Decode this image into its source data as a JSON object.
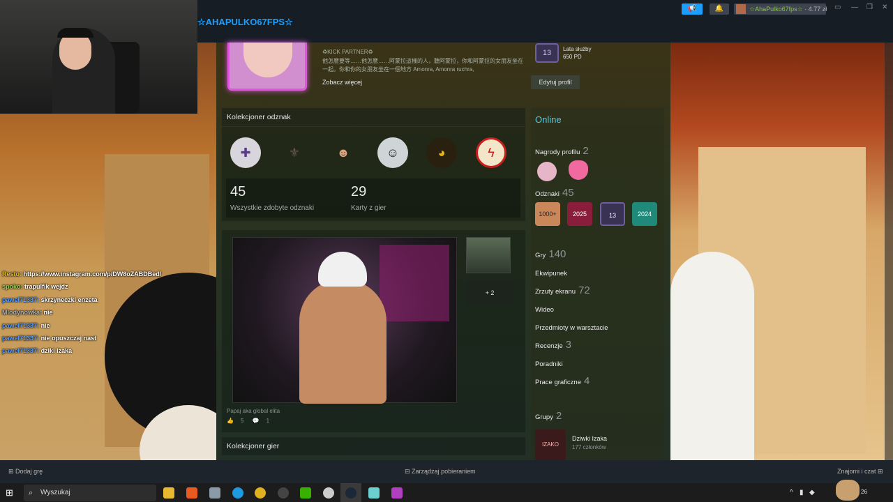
{
  "topbar": {
    "profile_name": "☆AHAPULKO67FPS☆",
    "user_chip_name": "☆AhaPulko67fps☆",
    "wallet": "4.77 zł"
  },
  "profile": {
    "kick_partner": "♻KICK PARTNER♻",
    "bio": "他怎麼要等……他怎麼……阿蒙拉這樣的人，聽阿蒙拉，你和阿蒙拉的女朋友坐在一起。你和你的女朋友坐在一個地方 Amonra, Amonra ruchra,",
    "see_more": "Zobacz więcej",
    "level": "13",
    "service_title": "Lata służby",
    "service_xp": "650 PD",
    "edit_profile": "Edytuj profil"
  },
  "badge_collector": {
    "title": "Kolekcjoner odznak",
    "badges": [
      "shield-badge",
      "skyrim-badge",
      "face-badge",
      "ghost-badge",
      "gold-helmet-badge",
      "lightning-badge"
    ],
    "total_badges": "45",
    "total_badges_label": "Wszystkie zdobyte odznaki",
    "cards": "29",
    "cards_label": "Karty z gier"
  },
  "showcase": {
    "more_count": "+ 2",
    "caption": "Papaj aka global elita",
    "likes": "5",
    "comments": "1"
  },
  "games_collector": {
    "title": "Kolekcjoner gier"
  },
  "sidebar": {
    "status": "Online",
    "awards_label": "Nagrody profilu",
    "awards_count": "2",
    "badges_label": "Odznaki",
    "badges_count": "45",
    "side_badges": [
      "1000+",
      "2025",
      "13",
      "2024"
    ],
    "games_label": "Gry",
    "games_count": "140",
    "inventory_label": "Ekwipunek",
    "screenshots_label": "Zrzuty ekranu",
    "screenshots_count": "72",
    "videos_label": "Wideo",
    "workshop_label": "Przedmioty w warsztacie",
    "reviews_label": "Recenzje",
    "reviews_count": "3",
    "guides_label": "Poradniki",
    "artwork_label": "Prace graficzne",
    "artwork_count": "4",
    "groups_label": "Grupy",
    "groups_count": "2",
    "group_name": "Dziwki Izaka",
    "group_members": "177 członków",
    "group_icon_text": "IZAKO BOARS"
  },
  "chat": [
    {
      "user": "Resto:",
      "msg": "https://www.instagram.com/p/DW8oZABDBed/"
    },
    {
      "user": "spoko:",
      "msg": "trapulfik wejdz"
    },
    {
      "user": "pawel71337:",
      "msg": "skrzyneczki enzeta"
    },
    {
      "user": "Mlodynowka:",
      "msg": "nie"
    },
    {
      "user": "pawel71337:",
      "msg": "nie"
    },
    {
      "user": "pawel71337:",
      "msg": "nie opuszczaj nast"
    },
    {
      "user": "pawel71337:",
      "msg": "dziki izaka"
    }
  ],
  "bottombar": {
    "add_game": "Dodaj grę",
    "downloads": "Zarządzaj pobieraniem",
    "friends": "Znajomi i czat"
  },
  "taskbar": {
    "search_placeholder": "Wyszukaj",
    "clock": "26"
  },
  "colors": {
    "steam_blue": "#1a9fff",
    "online": "#57cbde",
    "avatar_frame": "#e055e0"
  }
}
